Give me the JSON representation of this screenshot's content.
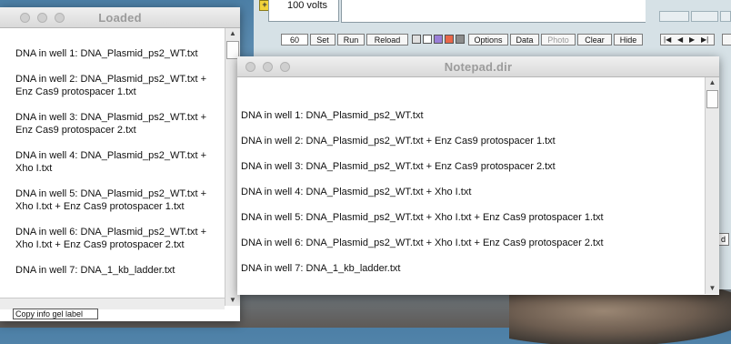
{
  "panel": {
    "volts": "100 volts",
    "plus_icon": "+",
    "toolbar": {
      "field_value": "60",
      "set": "Set",
      "run": "Run",
      "reload": "Reload",
      "options": "Options",
      "data": "Data",
      "photo": "Photo",
      "clear": "Clear",
      "hide": "Hide"
    },
    "swatch_colors": [
      "#e0e0e0",
      "#ffffff",
      "#9a7fd8",
      "#e8674a",
      "#8c8c8c"
    ],
    "nav": {
      "first": "|◀",
      "prev": "◀",
      "next": "▶",
      "last": "▶|"
    },
    "side_letter": "d"
  },
  "loaded_window": {
    "title": "Loaded",
    "lines": [
      "DNA in well 1:  DNA_Plasmid_ps2_WT.txt",
      "DNA in well 2:  DNA_Plasmid_ps2_WT.txt +",
      "Enz Cas9 protospacer 1.txt",
      "DNA in well 3:  DNA_Plasmid_ps2_WT.txt +",
      "Enz Cas9 protospacer 2.txt",
      "DNA in well 4:  DNA_Plasmid_ps2_WT.txt +",
      "Xho I.txt",
      "DNA in well 5:  DNA_Plasmid_ps2_WT.txt +",
      "Xho I.txt + Enz Cas9 protospacer 1.txt",
      "DNA in well 6:  DNA_Plasmid_ps2_WT.txt +",
      "Xho I.txt + Enz Cas9 protospacer 2.txt",
      "DNA in well 7:  DNA_1_kb_ladder.txt"
    ],
    "copy_button": "Copy info gel label"
  },
  "notepad_window": {
    "title": "Notepad.dir",
    "lines": [
      "DNA in well 1:  DNA_Plasmid_ps2_WT.txt",
      "DNA in well 2:  DNA_Plasmid_ps2_WT.txt + Enz Cas9 protospacer 1.txt",
      "DNA in well 3:  DNA_Plasmid_ps2_WT.txt + Enz Cas9 protospacer 2.txt",
      "DNA in well 4:  DNA_Plasmid_ps2_WT.txt + Xho I.txt",
      "DNA in well 5:  DNA_Plasmid_ps2_WT.txt + Xho I.txt + Enz Cas9 protospacer 1.txt",
      "DNA in well 6:  DNA_Plasmid_ps2_WT.txt + Xho I.txt + Enz Cas9 protospacer 2.txt",
      "DNA in well 7:  DNA_1_kb_ladder.txt"
    ]
  }
}
